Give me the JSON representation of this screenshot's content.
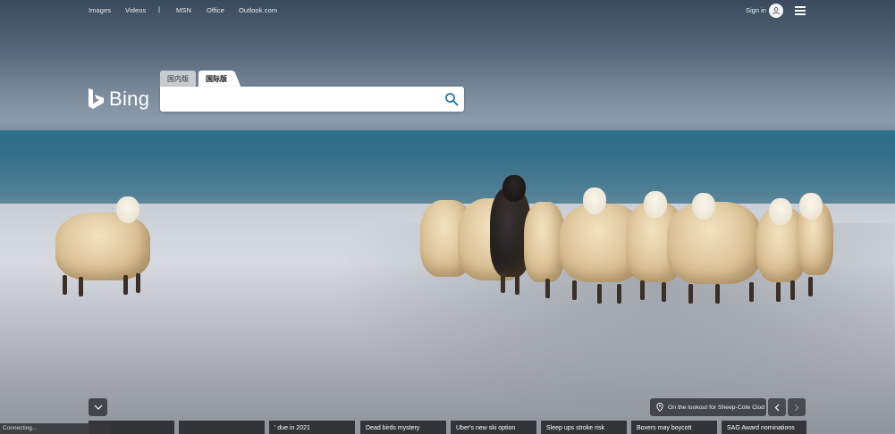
{
  "nav": {
    "links": [
      "Images",
      "Videos",
      "MSN",
      "Office",
      "Outlook.com"
    ],
    "separator": "|",
    "signin": "Sign in"
  },
  "logo": {
    "text": "Bing"
  },
  "search": {
    "tabs": [
      "国内版",
      "国际版"
    ],
    "active_tab": "国际版",
    "value": "",
    "placeholder": ""
  },
  "image_info": {
    "caption": "On the lookout for Sheep-Cote Clod"
  },
  "news": [
    "' due in 2021",
    "Dead birds mystery",
    "Uber's new ski option",
    "Sleep ups stroke risk",
    "Boxers may boycott",
    "SAG Award nominations"
  ],
  "status_bar": {
    "text": "Connecting..."
  }
}
